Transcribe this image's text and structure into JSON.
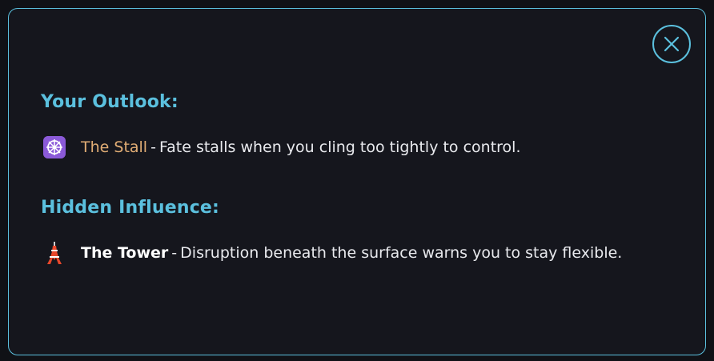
{
  "outlook": {
    "heading": "Your Outlook:",
    "card_name": "The Stall",
    "separator": "-",
    "description": "Fate stalls when you cling too tightly to control.",
    "icon": "dharma-wheel-icon",
    "name_color": "#e1ad75"
  },
  "influence": {
    "heading": "Hidden Influence:",
    "card_name": "The Tower",
    "separator": "-",
    "description": "Disruption beneath the surface warns you to stay flexible.",
    "icon": "tower-icon"
  },
  "theme": {
    "accent": "#5bc0de",
    "modal_bg": "#15161d"
  }
}
